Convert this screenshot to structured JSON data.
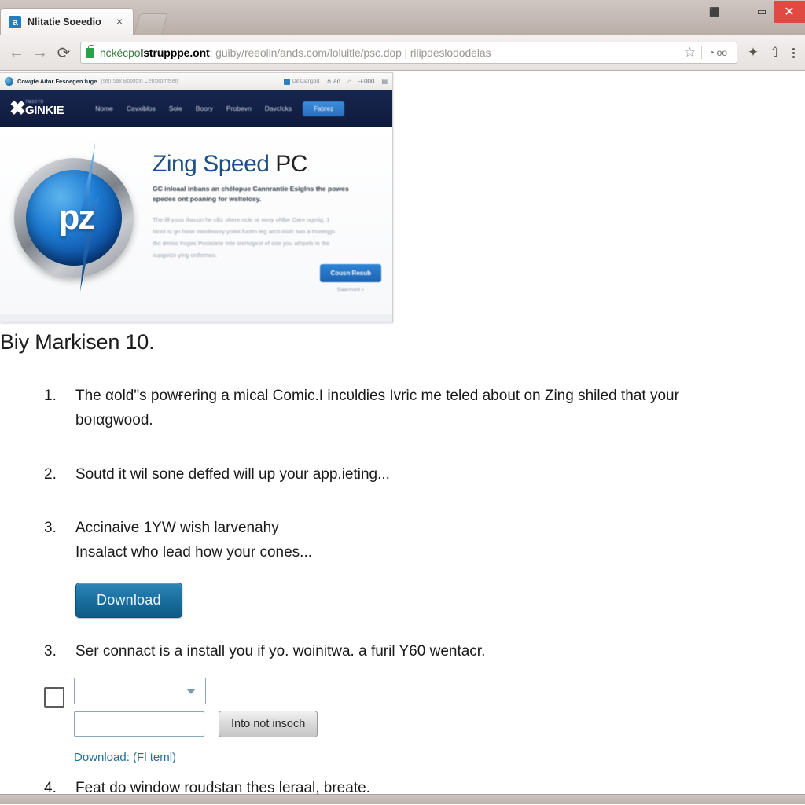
{
  "browser": {
    "tab": {
      "title": "Nlitatie Soeedio",
      "favicon_glyph": "a",
      "close_glyph": "×"
    },
    "window_controls": {
      "extra_glyph": "⬛",
      "minimize_glyph": "–",
      "maximize_glyph": "▭",
      "close_glyph": "✕"
    },
    "nav": {
      "back_glyph": "←",
      "forward_glyph": "→",
      "reload_glyph": "⟳"
    },
    "omnibox": {
      "secure": true,
      "host_prefix": "hckécpo",
      "host_bold": "lstrupppe.ont",
      "host_colon": ":",
      "path": " guiby/reeolin/ands.com/loluitle/psc.dop | rilipdeslododelas",
      "star_glyph": "☆",
      "badge_glyph": "◔",
      "badge_label": "oo"
    },
    "toolbar_icons": {
      "extension_glyph": "✦",
      "share_glyph": "⇧",
      "menu_glyph": "⋮"
    }
  },
  "embedded_screenshot": {
    "topbar": {
      "title": "Cowgte Aitor Fesoegen fuge",
      "subtitle": "[sel) 5ax Bolxfoin Cenxkomfsely",
      "chip_label": "Dit Ciangort",
      "mini_1": "⋔ ad",
      "mini_2": "⌂",
      "mini_3": "-£000",
      "mini_4": "▤"
    },
    "nav": {
      "logo_mark": "✖",
      "logo_small": "7M3DYD",
      "logo_large": "GINKIE",
      "links": [
        "Nome",
        "Cavxiblos",
        "Sole",
        "Boory",
        "Probevn",
        "Davcfcks"
      ],
      "button": "Fabrez"
    },
    "hero": {
      "orb_text": "pz",
      "title_blue": "Zing Speed",
      "title_dark": "PC",
      "title_tail": ".",
      "lede": "GC inloaal inbans an chélopue Cannrantie Esiglns the powes spedes ont poaning for wsltolosy.",
      "body": "The illl yous thacon he clliz shere ocle or nosy ohlbe Oare ogetig, 1 fóoot st gn htow trierdeoory yolint fuotrn leg arcb inidc two a threeqgs tho dmlso lroges Pociislete mte olertogxot of ooe you athpels in the supgoize ying ordlemas.",
      "cta": "Cousn Resub",
      "cta_sub": "Saarmsnt ɨ-"
    }
  },
  "article": {
    "heading": "Biy Markisen 10.",
    "steps": [
      {
        "num": "1.",
        "lines": [
          "The αold\"s powғering a mical Comic.I incυldies  Ivric me teled about on Zing shiled that your",
          "boıαɡwood."
        ]
      },
      {
        "num": "2.",
        "lines": [
          "Soutd it wil sone deffed will up your app.ieting..."
        ]
      },
      {
        "num": "3.",
        "lines": [
          "Accinaive 1YW wish larvenahy",
          "Insalact who lead how your cones..."
        ]
      }
    ],
    "download_button": "Download",
    "step_after_download": {
      "num": "3.",
      "text": "Ser connact is a install you if yo. woinitwa. a furil Y60 wentacr."
    },
    "form": {
      "checkbox_checked": false,
      "select_value": "",
      "text_value": "",
      "text_placeholder": "",
      "action_button": "Into not insoch",
      "download_link": "Download:  (Fl teml)"
    },
    "final_step": {
      "num": "4.",
      "text": "Feat do window roudstan theѕ leraal, breate."
    }
  }
}
